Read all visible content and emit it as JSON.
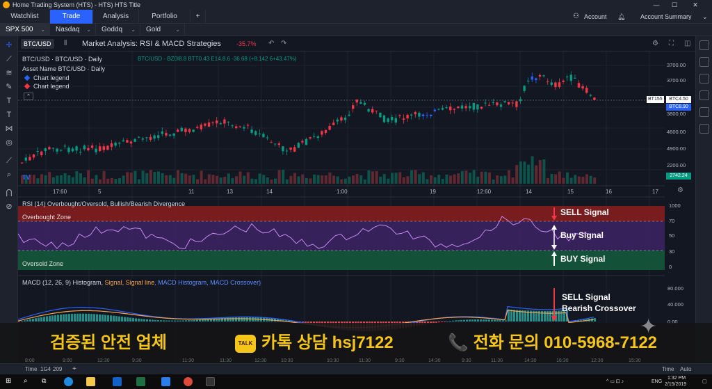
{
  "window": {
    "title": "Home Trading System (HTS) - HTS) HTS Title",
    "minimize": "—",
    "maximize": "☐",
    "close": "✕"
  },
  "menu": {
    "tabs": [
      "Watchlist",
      "Trade",
      "Analysis",
      "Portfolio"
    ],
    "active_tab": 1,
    "add": "+",
    "account": "Account",
    "account_summary": "Account Summary"
  },
  "symbols": [
    "SPX 500",
    "Nasdaq",
    "Goddq",
    "Gold"
  ],
  "chart_header": {
    "symbol": "BTC/USD",
    "title": "Market Analysis: RSI & MACD Strategies",
    "change": "-35.7%"
  },
  "price_pane": {
    "legend_title": "BTC/USD · BTC/USD · Daily",
    "ohlc": "BTC/USD - BZ0I8.8  BTT0.43  E14.8.6  -36.68  (+8.142  6+43.47%)",
    "asset_name": "Asset Name  BTC/USD · Daily",
    "legend_1": "Chart legend",
    "legend_2": "Chart legend",
    "legend_1_color": "#2962ff",
    "legend_2_color": "#f23645",
    "price_ticks": [
      "3700.00",
      "3700.00",
      "3800.00",
      "4600.00",
      "4900.00",
      "2200.00"
    ],
    "price_tag_1": "BTC4.50",
    "price_tag_1_left": "BT155",
    "price_tag_2": "BTC8.90",
    "volume_tag": "2742.24",
    "time_ticks": [
      "17:60",
      "5",
      "11",
      "13",
      "14",
      "1:00",
      "19",
      "12:60",
      "14",
      "15",
      "16",
      "17"
    ]
  },
  "rsi_pane": {
    "label": "RSI (14) Overbought/Oversold, Bullish/Bearish Divergence",
    "overbought": "Overbought Zone",
    "oversold": "Oversold Zone",
    "sell": "SELL Signal",
    "buy_mid": "Buy Signal",
    "buy": "BUY Signal",
    "ticks": [
      "1000",
      "70",
      "50",
      "30",
      "0"
    ]
  },
  "macd_pane": {
    "label_main": "MACD (12, 26, 9) Histogram, ",
    "label_signal": "Signal, Signal line",
    "label_rest": ", MACD Histogram, MACD Crossover)",
    "sell": "SELL Signal",
    "bearish": "Bearish Crossover",
    "ticks": [
      "80.000",
      "40.000",
      "0.00"
    ]
  },
  "banner": {
    "text1": "검증된 안전 업체",
    "talk_icon": "TALK",
    "text2": "카톡 상담 hsj7122",
    "phone_icon": "📞",
    "text3": "전화 문의 010-5968-7122"
  },
  "bottom": {
    "time_label": "Time",
    "range_1": "1G4",
    "range_2": "209",
    "add": "+",
    "time_right": "Time",
    "auto": "Auto",
    "ticks": [
      "8:00",
      "9:00",
      "12:30",
      "9:30",
      "11:30",
      "11:30",
      "12:30",
      "10:30",
      "10:30",
      "11:30",
      "9:30",
      "14:30",
      "9:30",
      "11:30",
      "14:30",
      "16:30",
      "12:30",
      "15:30"
    ]
  },
  "taskbar": {
    "lang": "ENG",
    "time": "1:32 PM",
    "date": "2/15/2019"
  },
  "colors": {
    "up": "#089981",
    "down": "#f23645",
    "accent": "#2962ff",
    "banner": "#f5c518"
  }
}
